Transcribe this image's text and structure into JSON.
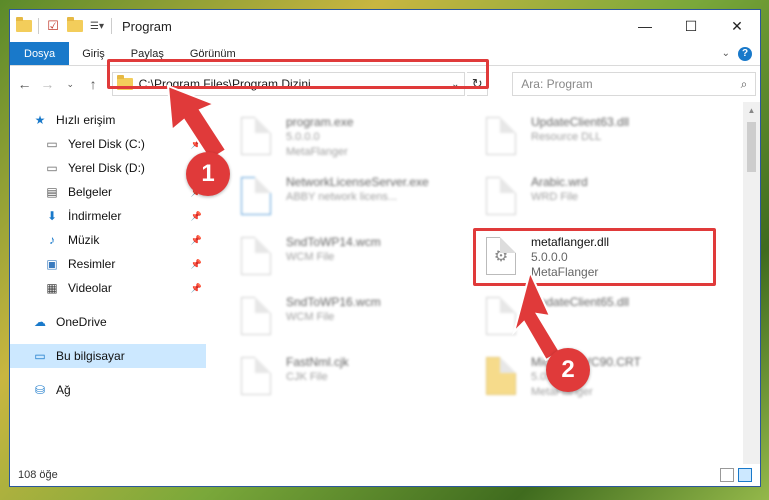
{
  "window": {
    "title": "Program"
  },
  "ribbon": {
    "tabs": [
      "Dosya",
      "Giriş",
      "Paylaş",
      "Görünüm"
    ]
  },
  "nav": {
    "address_path": "C:\\Program Files\\Program Dizini",
    "search_placeholder": "Ara: Program"
  },
  "sidebar": {
    "items": [
      {
        "label": "Hızlı erişim",
        "icon": "star-icon"
      },
      {
        "label": "Yerel Disk (C:)",
        "icon": "drive-icon"
      },
      {
        "label": "Yerel Disk (D:)",
        "icon": "drive-icon"
      },
      {
        "label": "Belgeler",
        "icon": "documents-icon"
      },
      {
        "label": "İndirmeler",
        "icon": "download-icon"
      },
      {
        "label": "Müzik",
        "icon": "music-icon"
      },
      {
        "label": "Resimler",
        "icon": "pictures-icon"
      },
      {
        "label": "Videolar",
        "icon": "video-icon"
      },
      {
        "label": "OneDrive",
        "icon": "cloud-icon"
      },
      {
        "label": "Bu bilgisayar",
        "icon": "computer-icon"
      },
      {
        "label": "Ağ",
        "icon": "network-icon"
      }
    ]
  },
  "files": [
    {
      "name": "program.exe",
      "line2": "5.0.0.0",
      "line3": "MetaFlanger"
    },
    {
      "name": "UpdateClient63.dll",
      "line2": "Resource DLL",
      "line3": ""
    },
    {
      "name": "NetworkLicenseServer.exe",
      "line2": "ABBY network licens...",
      "line3": ""
    },
    {
      "name": "Arabic.wrd",
      "line2": "WRD File",
      "line3": ""
    },
    {
      "name": "SndToWP14.wcm",
      "line2": "WCM File",
      "line3": ""
    },
    {
      "name": "metaflanger.dll",
      "line2": "5.0.0.0",
      "line3": "MetaFlanger"
    },
    {
      "name": "SndToWP16.wcm",
      "line2": "WCM File",
      "line3": ""
    },
    {
      "name": "UpdateClient65.dll",
      "line2": "",
      "line3": ""
    },
    {
      "name": "FastNml.cjk",
      "line2": "CJK File",
      "line3": ""
    },
    {
      "name": "Microsoft.VC90.CRT",
      "line2": "5.0.0.0",
      "line3": "MetaFlanger"
    }
  ],
  "status": {
    "count": "108 öğe"
  },
  "callouts": [
    "1",
    "2"
  ],
  "colors": {
    "accent": "#1979ca",
    "highlight": "#e03a3a"
  }
}
